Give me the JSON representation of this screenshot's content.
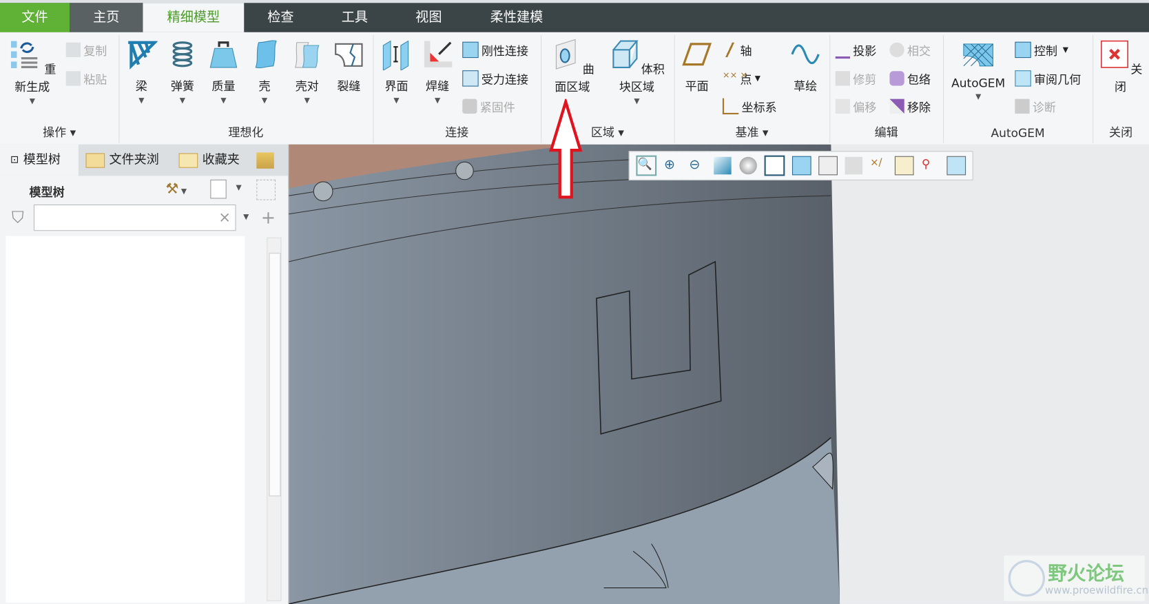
{
  "tabs": {
    "file": "文件",
    "home": "主页",
    "refine": "精细模型",
    "inspect": "检查",
    "tools": "工具",
    "view": "视图",
    "flex": "柔性建模"
  },
  "ribbon": {
    "operations": {
      "label": "操作",
      "regenerate": "重新生成",
      "copy": "复制",
      "paste": "粘贴"
    },
    "idealization": {
      "label": "理想化",
      "beam": "梁",
      "spring": "弹簧",
      "mass": "质量",
      "shell": "壳",
      "shell_pair": "壳对",
      "crack": "裂缝"
    },
    "connections": {
      "label": "连接",
      "interface": "界面",
      "weld": "焊缝",
      "rigid_link": "刚性连接",
      "weighted_link": "受力连接",
      "fastener": "紧固件"
    },
    "regions": {
      "label": "区域",
      "surface_region": "曲面区域",
      "volume_region": "体积块区域"
    },
    "datum": {
      "label": "基准",
      "plane": "平面",
      "axis": "轴",
      "point": "点",
      "csys": "坐标系",
      "sketch": "草绘"
    },
    "edit": {
      "label": "编辑",
      "project": "投影",
      "intersect": "相交",
      "trim": "修剪",
      "wrap": "包络",
      "offset": "偏移",
      "remove": "移除"
    },
    "autogem": {
      "label": "AutoGEM",
      "autogem": "AutoGEM",
      "control": "控制",
      "review_geometry": "审阅几何",
      "diagnostics": "诊断"
    },
    "close": {
      "label": "关闭",
      "close": "关闭"
    }
  },
  "left_panel": {
    "tabs": {
      "model_tree": "模型树",
      "folder_browser": "文件夹浏",
      "favorites": "收藏夹"
    },
    "title": "模型树",
    "search_value": "",
    "search_clear": "×"
  },
  "watermark": {
    "title": "野火论坛",
    "url": "www.proewildfire.cn"
  },
  "colors": {
    "accent_green": "#5fb236",
    "tab_dark": "#3b4446",
    "arrow_red": "#e0141e"
  }
}
